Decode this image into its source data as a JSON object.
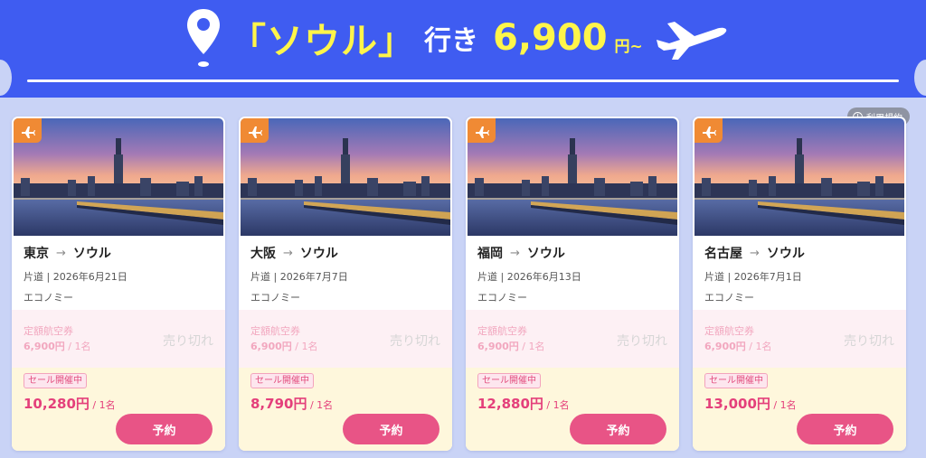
{
  "banner": {
    "destination_label": "「ソウル」",
    "suffix": "行き",
    "price": "6,900",
    "price_unit": "円~"
  },
  "terms_label": "利用規約",
  "colors": {
    "banner_bg": "#3f5cf1",
    "accent_yellow": "#fff54a",
    "book_button": "#e85486",
    "plane_badge": "#f08a34"
  },
  "cards": [
    {
      "origin": "東京",
      "arrow": "→",
      "destination": "ソウル",
      "trip": "片道 | 2026年6月21日",
      "cabin": "エコノミー",
      "fixed_label": "定額航空券",
      "fixed_price": "6,900円",
      "fixed_per": " / 1名",
      "soldout": "売り切れ",
      "sale_badge": "セール開催中",
      "sale_price": "10,280円",
      "sale_per": " / 1名",
      "book_label": "予約"
    },
    {
      "origin": "大阪",
      "arrow": "→",
      "destination": "ソウル",
      "trip": "片道 | 2026年7月7日",
      "cabin": "エコノミー",
      "fixed_label": "定額航空券",
      "fixed_price": "6,900円",
      "fixed_per": " / 1名",
      "soldout": "売り切れ",
      "sale_badge": "セール開催中",
      "sale_price": "8,790円",
      "sale_per": " / 1名",
      "book_label": "予約"
    },
    {
      "origin": "福岡",
      "arrow": "→",
      "destination": "ソウル",
      "trip": "片道 | 2026年6月13日",
      "cabin": "エコノミー",
      "fixed_label": "定額航空券",
      "fixed_price": "6,900円",
      "fixed_per": " / 1名",
      "soldout": "売り切れ",
      "sale_badge": "セール開催中",
      "sale_price": "12,880円",
      "sale_per": " / 1名",
      "book_label": "予約"
    },
    {
      "origin": "名古屋",
      "arrow": "→",
      "destination": "ソウル",
      "trip": "片道 | 2026年7月1日",
      "cabin": "エコノミー",
      "fixed_label": "定額航空券",
      "fixed_price": "6,900円",
      "fixed_per": " / 1名",
      "soldout": "売り切れ",
      "sale_badge": "セール開催中",
      "sale_price": "13,000円",
      "sale_per": " / 1名",
      "book_label": "予約"
    }
  ]
}
